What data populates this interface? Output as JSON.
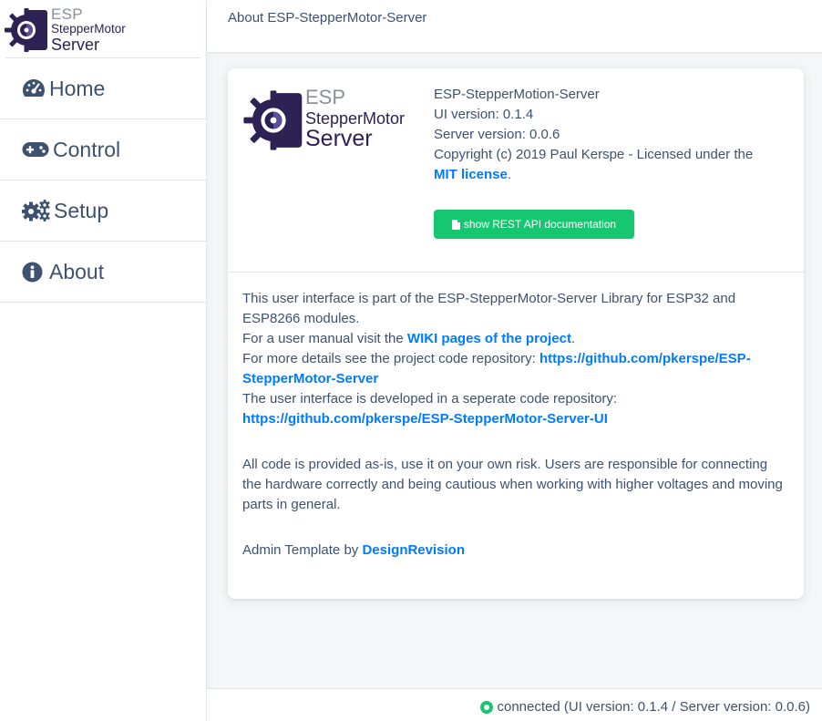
{
  "brand": {
    "line1": "ESP",
    "line2": "StepperMotor",
    "line3": "Server"
  },
  "colors": {
    "accent": "#007bff",
    "success": "#17c671",
    "text": "#3d5170",
    "logo_dark": "#2d2253"
  },
  "sidebar": {
    "items": [
      {
        "label": "Home",
        "icon": "tachometer-icon"
      },
      {
        "label": "Control",
        "icon": "gamepad-icon"
      },
      {
        "label": "Setup",
        "icon": "gears-icon"
      },
      {
        "label": "About",
        "icon": "info-circle-icon"
      }
    ]
  },
  "header": {
    "title": "About ESP-StepperMotor-Server"
  },
  "about": {
    "product_name": "ESP-StepperMotion-Server",
    "ui_version": "UI version: 0.1.4",
    "server_version": "Server version: 0.0.6",
    "copyright": "Copyright (c) 2019 Paul Kerspe - Licensed under the",
    "license_link": "MIT license",
    "license_suffix": ".",
    "api_button": "show REST API documentation",
    "p1_line1": "This user interface is part of the ESP-StepperMotor-Server Library for ESP32 and ESP8266 modules.",
    "p1_line2_prefix": "For a user manual visit the",
    "p1_line2_link": "WIKI pages of the project",
    "p1_line2_suffix": ".",
    "p1_line3_prefix": "For more details see the project code repository:",
    "p1_line3_link": "https://github.com/pkerspe/ESP-StepperMotor-Server",
    "p1_line4_prefix": "The user interface is developed in a seperate code repository:",
    "p1_line4_link": "https://github.com/pkerspe/ESP-StepperMotor-Server-UI",
    "p2": "All code is provided as-is, use it on your own risk. Users are responsible for connecting the hardware correctly and being cautious when working with higher voltages and moving parts in general.",
    "p3_prefix": "Admin Template by",
    "p3_link": "DesignRevision"
  },
  "footer": {
    "status": "connected (UI version: 0.1.4 / Server version: 0.0.6)"
  }
}
